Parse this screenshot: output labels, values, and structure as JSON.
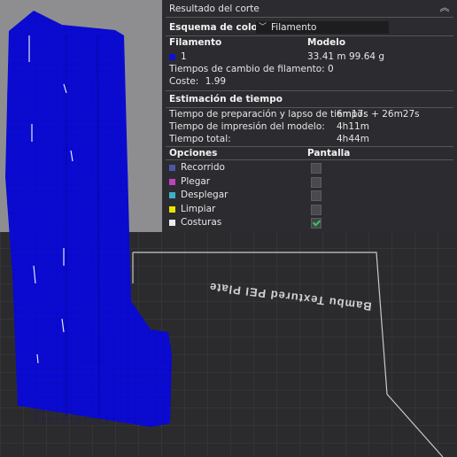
{
  "panel": {
    "title": "Resultado del corte",
    "color_scheme_label": "Esquema de colores",
    "color_scheme_value": "Filamento",
    "filament_header": "Filamento",
    "model_header": "Modelo",
    "filament_row": {
      "index": "1",
      "length": "33.41 m",
      "weight": "99.64 g",
      "color": "#1010d0"
    },
    "filament_changes_label": "Tiempos de cambio de filamento:",
    "filament_changes_value": "0",
    "cost_label": "Coste:",
    "cost_value": "1.99",
    "time_header": "Estimación de tiempo",
    "prep_label": "Tiempo de preparación y lapso de tiempo:",
    "prep_value": "6m17s + 26m27s",
    "print_label": "Tiempo de impresión del modelo:",
    "print_value": "4h11m",
    "total_label": "Tiempo total:",
    "total_value": "4h44m",
    "options_header": "Opciones",
    "display_header": "Pantalla",
    "options": [
      {
        "label": "Recorrido",
        "color": "#4a56a8",
        "checked": false
      },
      {
        "label": "Plegar",
        "color": "#c040c0",
        "checked": false
      },
      {
        "label": "Desplegar",
        "color": "#3cb0c8",
        "checked": false
      },
      {
        "label": "Limpiar",
        "color": "#e6e600",
        "checked": false
      },
      {
        "label": "Costuras",
        "color": "#ececec",
        "checked": true
      }
    ]
  },
  "plate_label": "Bambu Textured PEI Plate",
  "colors": {
    "model": "#0a0ad2",
    "plate": "#2b2b2e",
    "background": "#8e8e91"
  }
}
